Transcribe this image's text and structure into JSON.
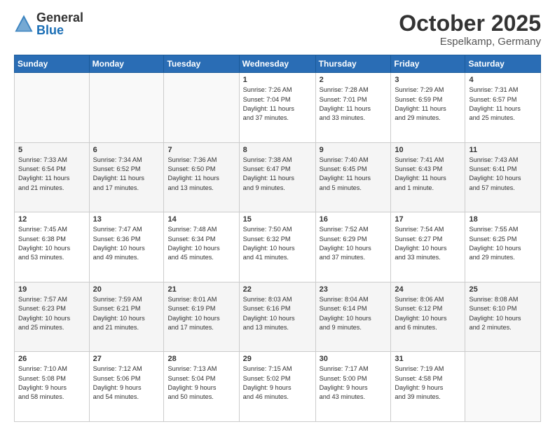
{
  "header": {
    "logo_general": "General",
    "logo_blue": "Blue",
    "month_title": "October 2025",
    "location": "Espelkamp, Germany"
  },
  "days_of_week": [
    "Sunday",
    "Monday",
    "Tuesday",
    "Wednesday",
    "Thursday",
    "Friday",
    "Saturday"
  ],
  "weeks": [
    [
      {
        "day": "",
        "info": ""
      },
      {
        "day": "",
        "info": ""
      },
      {
        "day": "",
        "info": ""
      },
      {
        "day": "1",
        "info": "Sunrise: 7:26 AM\nSunset: 7:04 PM\nDaylight: 11 hours\nand 37 minutes."
      },
      {
        "day": "2",
        "info": "Sunrise: 7:28 AM\nSunset: 7:01 PM\nDaylight: 11 hours\nand 33 minutes."
      },
      {
        "day": "3",
        "info": "Sunrise: 7:29 AM\nSunset: 6:59 PM\nDaylight: 11 hours\nand 29 minutes."
      },
      {
        "day": "4",
        "info": "Sunrise: 7:31 AM\nSunset: 6:57 PM\nDaylight: 11 hours\nand 25 minutes."
      }
    ],
    [
      {
        "day": "5",
        "info": "Sunrise: 7:33 AM\nSunset: 6:54 PM\nDaylight: 11 hours\nand 21 minutes."
      },
      {
        "day": "6",
        "info": "Sunrise: 7:34 AM\nSunset: 6:52 PM\nDaylight: 11 hours\nand 17 minutes."
      },
      {
        "day": "7",
        "info": "Sunrise: 7:36 AM\nSunset: 6:50 PM\nDaylight: 11 hours\nand 13 minutes."
      },
      {
        "day": "8",
        "info": "Sunrise: 7:38 AM\nSunset: 6:47 PM\nDaylight: 11 hours\nand 9 minutes."
      },
      {
        "day": "9",
        "info": "Sunrise: 7:40 AM\nSunset: 6:45 PM\nDaylight: 11 hours\nand 5 minutes."
      },
      {
        "day": "10",
        "info": "Sunrise: 7:41 AM\nSunset: 6:43 PM\nDaylight: 11 hours\nand 1 minute."
      },
      {
        "day": "11",
        "info": "Sunrise: 7:43 AM\nSunset: 6:41 PM\nDaylight: 10 hours\nand 57 minutes."
      }
    ],
    [
      {
        "day": "12",
        "info": "Sunrise: 7:45 AM\nSunset: 6:38 PM\nDaylight: 10 hours\nand 53 minutes."
      },
      {
        "day": "13",
        "info": "Sunrise: 7:47 AM\nSunset: 6:36 PM\nDaylight: 10 hours\nand 49 minutes."
      },
      {
        "day": "14",
        "info": "Sunrise: 7:48 AM\nSunset: 6:34 PM\nDaylight: 10 hours\nand 45 minutes."
      },
      {
        "day": "15",
        "info": "Sunrise: 7:50 AM\nSunset: 6:32 PM\nDaylight: 10 hours\nand 41 minutes."
      },
      {
        "day": "16",
        "info": "Sunrise: 7:52 AM\nSunset: 6:29 PM\nDaylight: 10 hours\nand 37 minutes."
      },
      {
        "day": "17",
        "info": "Sunrise: 7:54 AM\nSunset: 6:27 PM\nDaylight: 10 hours\nand 33 minutes."
      },
      {
        "day": "18",
        "info": "Sunrise: 7:55 AM\nSunset: 6:25 PM\nDaylight: 10 hours\nand 29 minutes."
      }
    ],
    [
      {
        "day": "19",
        "info": "Sunrise: 7:57 AM\nSunset: 6:23 PM\nDaylight: 10 hours\nand 25 minutes."
      },
      {
        "day": "20",
        "info": "Sunrise: 7:59 AM\nSunset: 6:21 PM\nDaylight: 10 hours\nand 21 minutes."
      },
      {
        "day": "21",
        "info": "Sunrise: 8:01 AM\nSunset: 6:19 PM\nDaylight: 10 hours\nand 17 minutes."
      },
      {
        "day": "22",
        "info": "Sunrise: 8:03 AM\nSunset: 6:16 PM\nDaylight: 10 hours\nand 13 minutes."
      },
      {
        "day": "23",
        "info": "Sunrise: 8:04 AM\nSunset: 6:14 PM\nDaylight: 10 hours\nand 9 minutes."
      },
      {
        "day": "24",
        "info": "Sunrise: 8:06 AM\nSunset: 6:12 PM\nDaylight: 10 hours\nand 6 minutes."
      },
      {
        "day": "25",
        "info": "Sunrise: 8:08 AM\nSunset: 6:10 PM\nDaylight: 10 hours\nand 2 minutes."
      }
    ],
    [
      {
        "day": "26",
        "info": "Sunrise: 7:10 AM\nSunset: 5:08 PM\nDaylight: 9 hours\nand 58 minutes."
      },
      {
        "day": "27",
        "info": "Sunrise: 7:12 AM\nSunset: 5:06 PM\nDaylight: 9 hours\nand 54 minutes."
      },
      {
        "day": "28",
        "info": "Sunrise: 7:13 AM\nSunset: 5:04 PM\nDaylight: 9 hours\nand 50 minutes."
      },
      {
        "day": "29",
        "info": "Sunrise: 7:15 AM\nSunset: 5:02 PM\nDaylight: 9 hours\nand 46 minutes."
      },
      {
        "day": "30",
        "info": "Sunrise: 7:17 AM\nSunset: 5:00 PM\nDaylight: 9 hours\nand 43 minutes."
      },
      {
        "day": "31",
        "info": "Sunrise: 7:19 AM\nSunset: 4:58 PM\nDaylight: 9 hours\nand 39 minutes."
      },
      {
        "day": "",
        "info": ""
      }
    ]
  ]
}
